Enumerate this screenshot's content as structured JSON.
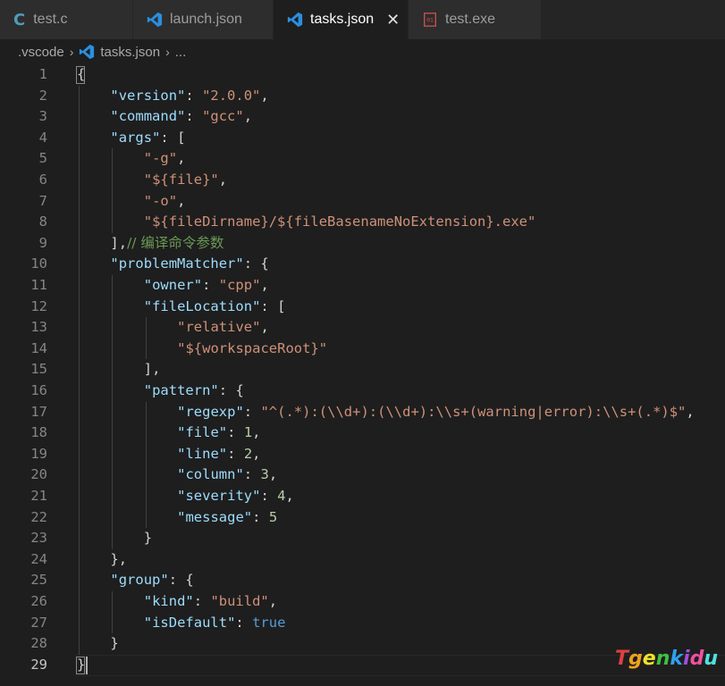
{
  "tabs": [
    {
      "label": "test.c",
      "icon": "c-file-icon",
      "active": false
    },
    {
      "label": "launch.json",
      "icon": "vscode-icon",
      "active": false
    },
    {
      "label": "tasks.json",
      "icon": "vscode-icon",
      "active": true,
      "close": "✕"
    },
    {
      "label": "test.exe",
      "icon": "binary-file-icon",
      "active": false
    }
  ],
  "breadcrumb": {
    "folder": ".vscode",
    "file": "tasks.json",
    "more": "...",
    "separator": "›"
  },
  "editor": {
    "lines": [
      {
        "num": "1",
        "code": "{"
      },
      {
        "num": "2",
        "code": "    \"version\": \"2.0.0\","
      },
      {
        "num": "3",
        "code": "    \"command\": \"gcc\","
      },
      {
        "num": "4",
        "code": "    \"args\": ["
      },
      {
        "num": "5",
        "code": "        \"-g\","
      },
      {
        "num": "6",
        "code": "        \"${file}\","
      },
      {
        "num": "7",
        "code": "        \"-o\","
      },
      {
        "num": "8",
        "code": "        \"${fileDirname}/${fileBasenameNoExtension}.exe\""
      },
      {
        "num": "9",
        "code": "    ],// 编译命令参数"
      },
      {
        "num": "10",
        "code": "    \"problemMatcher\": {"
      },
      {
        "num": "11",
        "code": "        \"owner\": \"cpp\","
      },
      {
        "num": "12",
        "code": "        \"fileLocation\": ["
      },
      {
        "num": "13",
        "code": "            \"relative\","
      },
      {
        "num": "14",
        "code": "            \"${workspaceRoot}\""
      },
      {
        "num": "15",
        "code": "        ],"
      },
      {
        "num": "16",
        "code": "        \"pattern\": {"
      },
      {
        "num": "17",
        "code": "            \"regexp\": \"^(.*):(\\\\d+):(\\\\d+):\\\\s+(warning|error):\\\\s+(.*)$\","
      },
      {
        "num": "18",
        "code": "            \"file\": 1,"
      },
      {
        "num": "19",
        "code": "            \"line\": 2,"
      },
      {
        "num": "20",
        "code": "            \"column\": 3,"
      },
      {
        "num": "21",
        "code": "            \"severity\": 4,"
      },
      {
        "num": "22",
        "code": "            \"message\": 5"
      },
      {
        "num": "23",
        "code": "        }"
      },
      {
        "num": "24",
        "code": "    },"
      },
      {
        "num": "25",
        "code": "    \"group\": {"
      },
      {
        "num": "26",
        "code": "        \"kind\": \"build\","
      },
      {
        "num": "27",
        "code": "        \"isDefault\": true"
      },
      {
        "num": "28",
        "code": "    }"
      },
      {
        "num": "29",
        "code": "}"
      }
    ],
    "current_line": "29"
  },
  "watermark": {
    "text": "Tgenkidu"
  },
  "colors": {
    "key": "#9cdcfe",
    "string": "#ce9178",
    "number": "#b5cea8",
    "boolean": "#569cd6",
    "comment": "#6a9955",
    "punct": "#d4d4d4"
  }
}
